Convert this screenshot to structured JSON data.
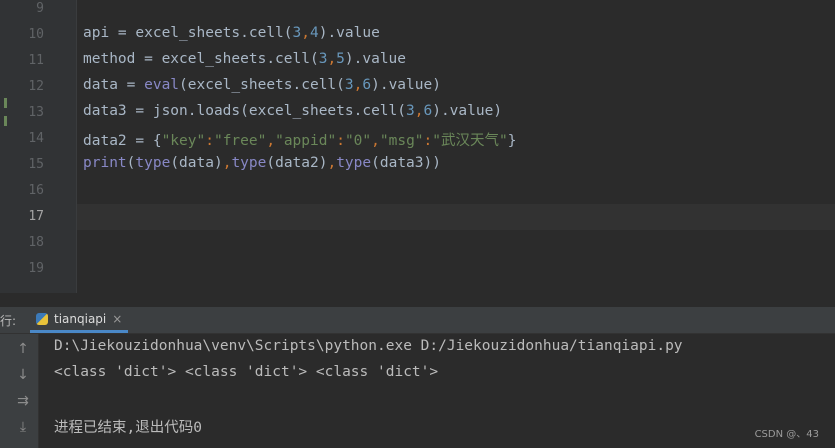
{
  "editor": {
    "line_numbers": [
      "9",
      "10",
      "11",
      "12",
      "13",
      "14",
      "15",
      "16",
      "17",
      "18",
      "19"
    ],
    "current_line": "17",
    "code": {
      "l10": {
        "a": "api = excel_sheets.cell(",
        "n1": "3",
        "sep": ",",
        "n2": "4",
        "b": ").value"
      },
      "l11": {
        "a": "method = excel_sheets.cell(",
        "n1": "3",
        "sep": ",",
        "n2": "5",
        "b": ").value"
      },
      "l12": {
        "fn": "eval",
        "a": "data = ",
        "b": "(excel_sheets.cell(",
        "n1": "3",
        "sep": ",",
        "n2": "6",
        "c": ").value)"
      },
      "l13": {
        "a": "data3 = json.loads(excel_sheets.cell(",
        "n1": "3",
        "sep": ",",
        "n2": "6",
        "b": ").value)"
      },
      "l14": {
        "a": "data2 = {",
        "k1": "\"key\"",
        "c1": ":",
        "v1": "\"free\"",
        "s1": ",",
        "k2": "\"appid\"",
        "c2": ":",
        "v2": "\"0\"",
        "s2": ",",
        "k3": "\"msg\"",
        "c3": ":",
        "v3": "\"武汉天气\"",
        "b": "}"
      },
      "l15": {
        "fn": "print",
        "t": "type",
        "a1": "(",
        "a2": "(data)",
        "s1": ",",
        "a3": "(data2)",
        "s2": ",",
        "a4": "(data3))"
      }
    }
  },
  "run_panel": {
    "label": "行:",
    "tab_label": "tianqiapi",
    "tab_close": "×",
    "console_lines": [
      "D:\\Jiekouzidonhua\\venv\\Scripts\\python.exe D:/Jiekouzidonhua/tianqiapi.py",
      "<class 'dict'> <class 'dict'> <class 'dict'>",
      "",
      "进程已结束,退出代码0"
    ]
  },
  "watermark": "CSDN @、43",
  "icons": [
    "up-arrow-icon",
    "down-arrow-icon",
    "soft-wrap-icon",
    "scroll-to-end-icon",
    "python-file-icon",
    "close-icon"
  ]
}
